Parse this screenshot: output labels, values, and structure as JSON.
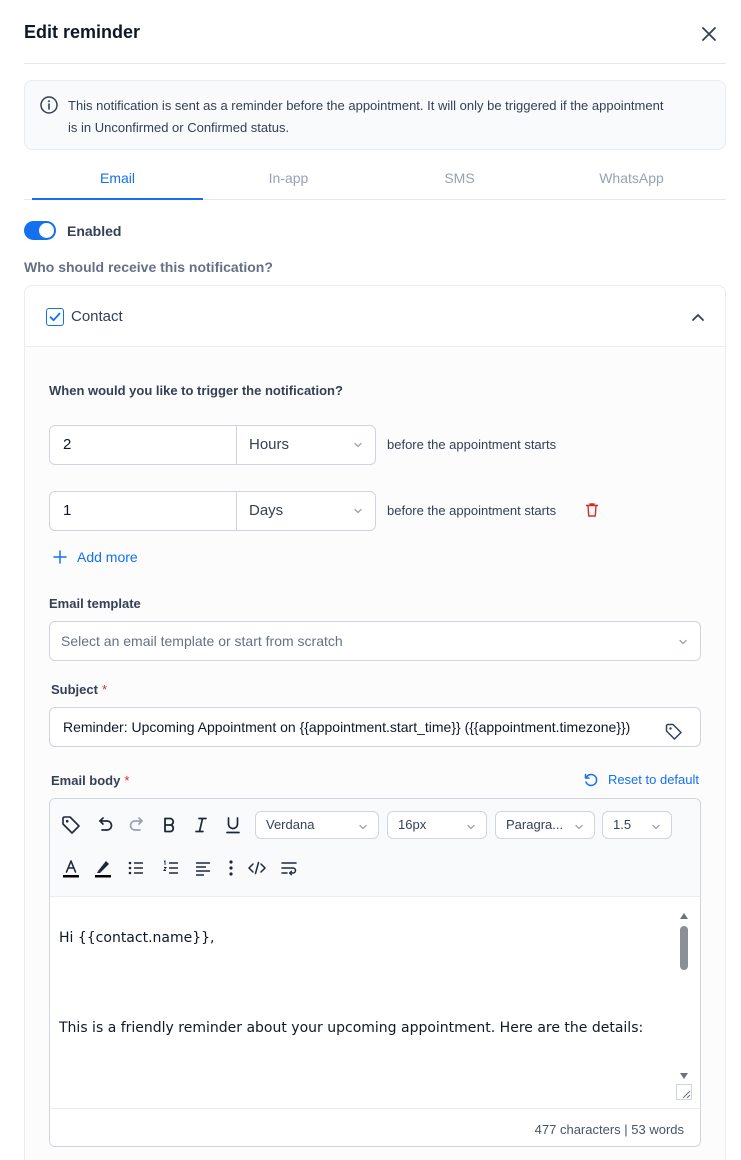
{
  "header": {
    "title": "Edit reminder"
  },
  "info": {
    "text": "This notification is sent as a reminder before the appointment. It will only be triggered if the appointment is in Unconfirmed or Confirmed status."
  },
  "tabs": [
    {
      "label": "Email",
      "active": true
    },
    {
      "label": "In-app",
      "active": false
    },
    {
      "label": "SMS",
      "active": false
    },
    {
      "label": "WhatsApp",
      "active": false
    }
  ],
  "enabled": {
    "label": "Enabled",
    "on": true
  },
  "recipients_question": "Who should receive this notification?",
  "contact": {
    "label": "Contact",
    "checked": true,
    "trigger_question": "When would you like to trigger the notification?",
    "triggers": [
      {
        "value": "2",
        "unit": "Hours",
        "suffix": "before the appointment starts"
      },
      {
        "value": "1",
        "unit": "Days",
        "suffix": "before the appointment starts"
      }
    ],
    "add_more": "Add more",
    "email_template": {
      "label": "Email template",
      "placeholder": "Select an email template or start from scratch"
    },
    "subject": {
      "label": "Subject",
      "required": "*",
      "value": "Reminder: Upcoming Appointment on {{appointment.start_time}} ({{appointment.timezone}})"
    },
    "email_body": {
      "label": "Email body",
      "required": "*",
      "reset_label": "Reset to default",
      "font": "Verdana",
      "font_size": "16px",
      "block_format": "Paragra...",
      "line_height": "1.5",
      "lines": [
        "Hi {{contact.name}},",
        "This is a friendly reminder about your upcoming appointment. Here are the details:"
      ],
      "counts": "477 characters | 53 words"
    }
  },
  "colors": {
    "accent": "#1570ef",
    "danger": "#d92d20",
    "border": "#d0d5dd"
  }
}
